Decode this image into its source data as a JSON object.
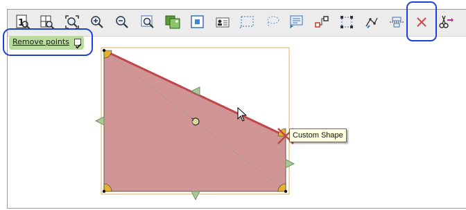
{
  "options": {
    "remove_points_label": "Remove points",
    "remove_points_checked": true
  },
  "toolbar": {
    "buttons": [
      {
        "name": "actual-size-icon"
      },
      {
        "name": "zoom-grid-icon"
      },
      {
        "name": "fit-page-icon"
      },
      {
        "name": "zoom-in-icon"
      },
      {
        "name": "zoom-out-icon"
      },
      {
        "name": "zoom-selection-icon"
      },
      {
        "name": "image-icon"
      },
      {
        "name": "frame-icon"
      },
      {
        "name": "contact-card-icon"
      },
      {
        "name": "dotted-rectangle-icon"
      },
      {
        "name": "lasso-icon"
      },
      {
        "name": "text-lines-icon"
      },
      {
        "name": "connector-icon"
      },
      {
        "name": "resize-handles-icon"
      },
      {
        "name": "edit-points-icon"
      },
      {
        "name": "align-icon"
      },
      {
        "name": "close-icon"
      },
      {
        "name": "cut-icon"
      }
    ]
  },
  "shape": {
    "tooltip": "Custom Shape",
    "fill_color": "#d09594",
    "edge_color": "#c0474a",
    "selection_color": "#e3b030"
  }
}
